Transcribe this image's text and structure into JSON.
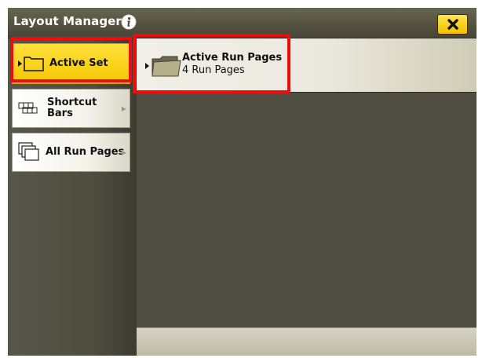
{
  "window": {
    "title": "Layout Manager"
  },
  "sidebar": {
    "items": [
      {
        "label": "Active Set",
        "selected": true
      },
      {
        "label_line1": "Shortcut",
        "label_line2": "Bars"
      },
      {
        "label": "All Run Pages"
      }
    ]
  },
  "content": {
    "folder": {
      "title": "Active Run Pages",
      "subtitle": "4 Run Pages"
    }
  },
  "icons": {
    "info": "info-icon",
    "close": "close-icon",
    "active_set": "active-set-folder-icon",
    "shortcut_bars": "shortcut-bars-icon",
    "all_run_pages": "all-run-pages-icon",
    "folder": "folder-icon"
  },
  "colors": {
    "accent": "#f4c700",
    "highlight": "#ee0d0d",
    "titlebar": "#55523f",
    "background": "#504d42"
  }
}
